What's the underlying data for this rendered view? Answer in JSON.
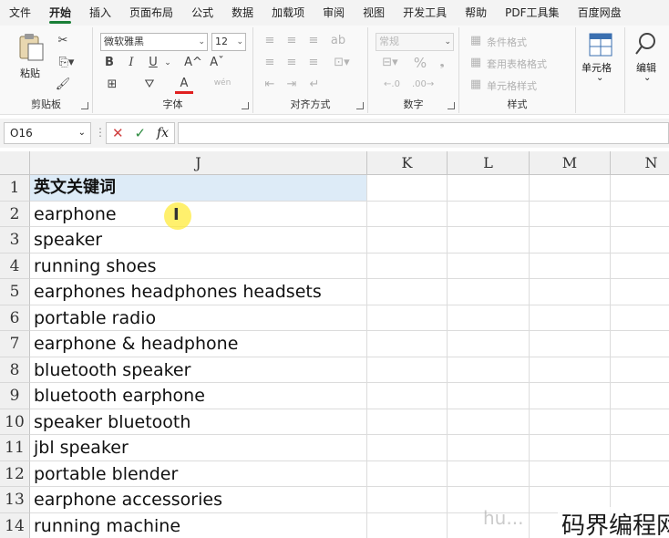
{
  "menu": [
    "文件",
    "开始",
    "插入",
    "页面布局",
    "公式",
    "数据",
    "加载项",
    "审阅",
    "视图",
    "开发工具",
    "帮助",
    "PDF工具集",
    "百度网盘"
  ],
  "ribbon": {
    "clipboard": {
      "label": "剪贴板",
      "paste": "粘贴"
    },
    "font": {
      "label": "字体",
      "name": "微软雅黑",
      "size": "12",
      "bold": "B",
      "italic": "I",
      "underline": "U",
      "grow": "A^",
      "shrink": "Aˇ",
      "color": "A",
      "phonetic": "wén"
    },
    "alignment": {
      "label": "对齐方式"
    },
    "number": {
      "label": "数字",
      "format": "常规",
      "percent": "%"
    },
    "styles": {
      "label": "样式",
      "conditional": "条件格式",
      "table": "套用表格格式",
      "cell_style": "单元格样式"
    },
    "cells": {
      "label": "单元格"
    },
    "editing": {
      "label": "编辑"
    }
  },
  "formula_bar": {
    "name_box": "O16",
    "fx": "fx",
    "value": ""
  },
  "columns": [
    "J",
    "K",
    "L",
    "M",
    "N"
  ],
  "rows": [
    "1",
    "2",
    "3",
    "4",
    "5",
    "6",
    "7",
    "8",
    "9",
    "10",
    "11",
    "12",
    "13",
    "14"
  ],
  "cells_j": [
    "英文关键词",
    "earphone",
    "speaker",
    "running shoes",
    "earphones headphones headsets",
    "portable radio",
    "earphone & headphone",
    "bluetooth speaker",
    "bluetooth earphone",
    "speaker bluetooth",
    "jbl speaker",
    "portable blender",
    "earphone accessories",
    "running machine"
  ],
  "watermark": {
    "left": "hu...",
    "right": "码界编程网"
  }
}
